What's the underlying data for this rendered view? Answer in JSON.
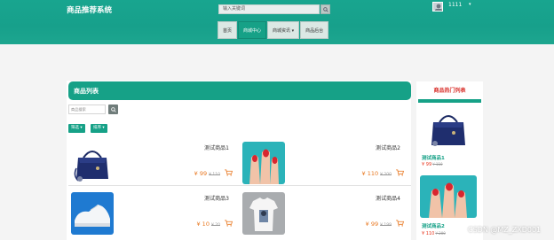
{
  "header": {
    "site_title": "商品推荐系统",
    "search_placeholder": "输入关键词",
    "username": "1111",
    "user_caret": "▾",
    "nav": [
      "首页",
      "商城中心",
      "商城资讯 ▾",
      "商品后台"
    ]
  },
  "list": {
    "title": "商品列表",
    "keyword_placeholder": "商品搜索",
    "filter_label": "筛选 ▾",
    "sort_label": "排序 ▾",
    "products": [
      {
        "name": "测试商品1",
        "price": "¥ 99",
        "old": "¥ 110"
      },
      {
        "name": "测试商品2",
        "price": "¥ 110",
        "old": "¥ 200"
      },
      {
        "name": "测试商品3",
        "price": "¥ 10",
        "old": "¥ 20"
      },
      {
        "name": "测试商品4",
        "price": "¥ 99",
        "old": "¥ 199"
      }
    ]
  },
  "hot": {
    "title": "商品热门列表",
    "items": [
      {
        "name": "测试商品1",
        "price": "¥ 99",
        "old": "¥ 110"
      },
      {
        "name": "测试商品2",
        "price": "¥ 110",
        "old": "¥ 200"
      }
    ]
  },
  "watermark": "CSDN @MZ_ZXD001",
  "colors": {
    "primary": "#16a187",
    "price": "#e8761e",
    "hot_title": "#d9322d"
  }
}
